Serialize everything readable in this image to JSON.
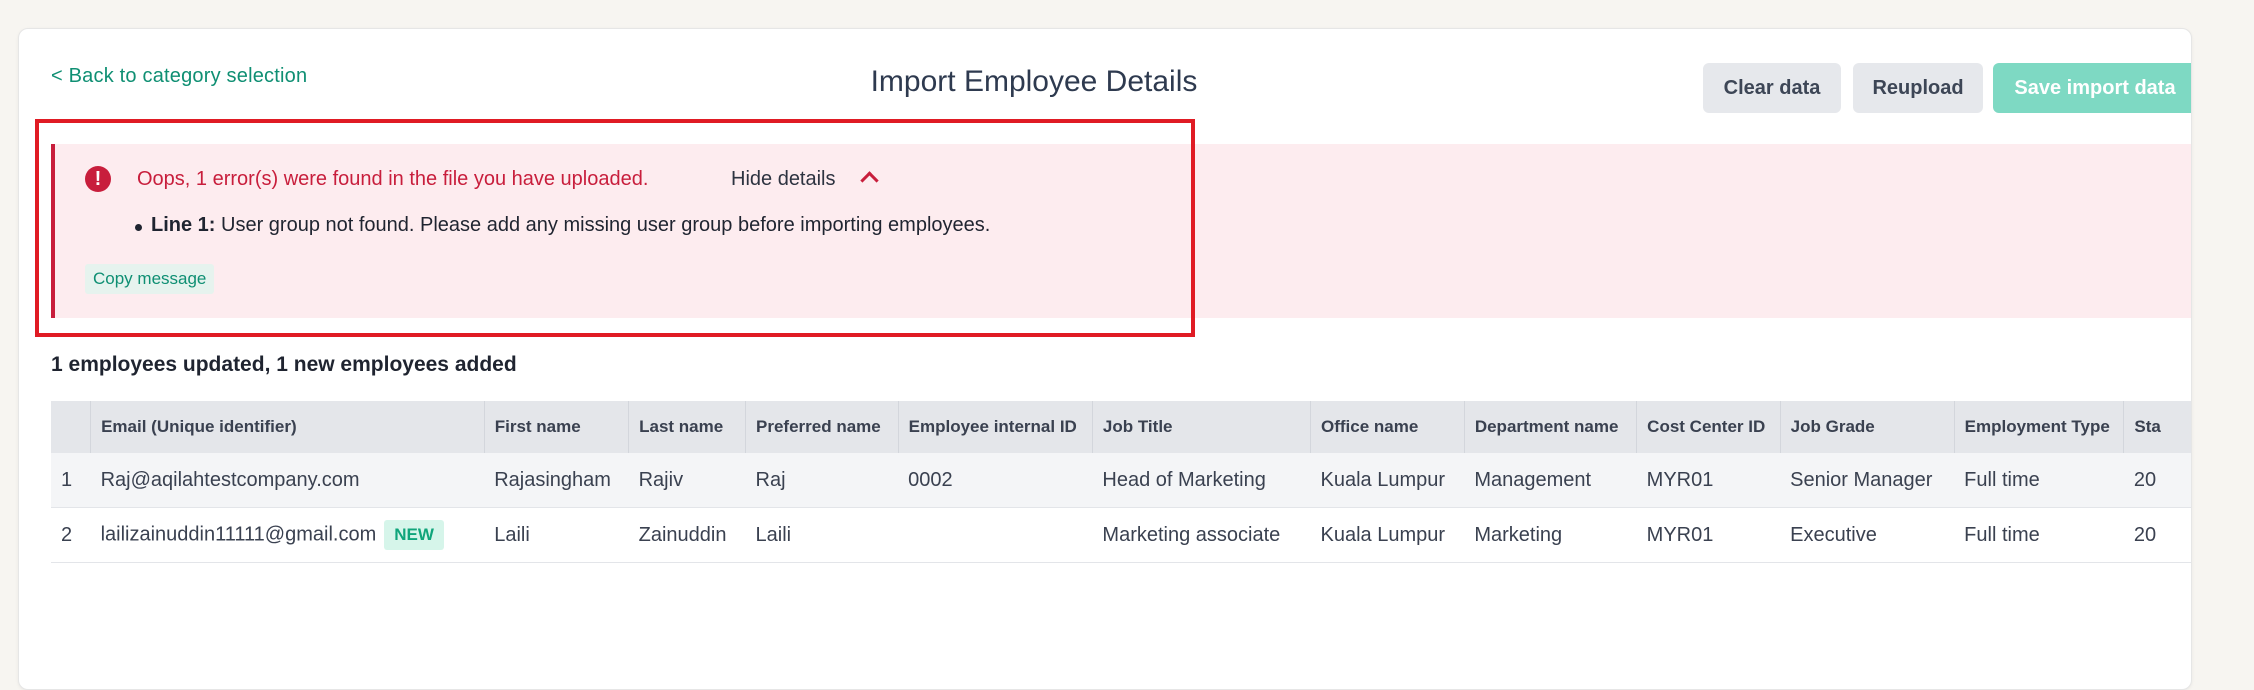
{
  "header": {
    "back_link": "< Back to category selection",
    "title": "Import Employee Details",
    "clear_label": "Clear data",
    "reupload_label": "Reupload",
    "save_label": "Save import data"
  },
  "error": {
    "icon": "!",
    "message": "Oops, 1 error(s) were found in the file you have uploaded.",
    "hide_details": "Hide details",
    "line_label": "Line 1:",
    "line_text": " User group not found. Please add any missing user group before importing employees.",
    "copy_label": "Copy message"
  },
  "summary": "1 employees updated, 1 new employees added",
  "table": {
    "columns": [
      "",
      "Email (Unique identifier)",
      "First name",
      "Last name",
      "Preferred name",
      "Employee internal ID",
      "Job Title",
      "Office name",
      "Department name",
      "Cost Center ID",
      "Job Grade",
      "Employment Type",
      "Sta"
    ],
    "rows": [
      [
        "1",
        "Raj@aqilahtestcompany.com",
        "Rajasingham",
        "Rajiv",
        "Raj",
        "0002",
        "Head of Marketing",
        "Kuala Lumpur",
        "Management",
        "MYR01",
        "Senior Manager",
        "Full time",
        "20"
      ],
      [
        "2",
        "lailizainuddin11111@gmail.com",
        "Laili",
        "Zainuddin",
        "Laili",
        "",
        "Marketing associate",
        "Kuala Lumpur",
        "Marketing",
        "MYR01",
        "Executive",
        "Full time",
        "20"
      ]
    ],
    "new_badge": "NEW"
  },
  "colors": {
    "accent": "#0f8f73",
    "error": "#c81e3c",
    "error_bg": "#fdecef",
    "highlight": "#e01b24"
  }
}
